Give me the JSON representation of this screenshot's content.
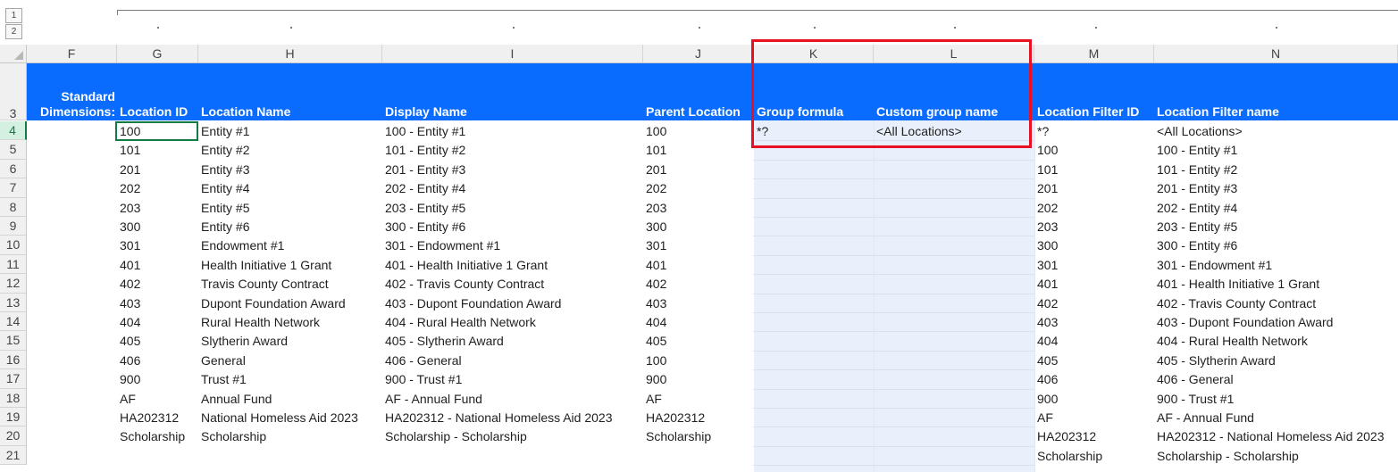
{
  "outline": {
    "levels": [
      "1",
      "2"
    ]
  },
  "columns": [
    {
      "letter": "F",
      "header": "Standard Dimensions:"
    },
    {
      "letter": "G",
      "header": "Location ID"
    },
    {
      "letter": "H",
      "header": "Location Name"
    },
    {
      "letter": "I",
      "header": "Display Name"
    },
    {
      "letter": "J",
      "header": "Parent Location"
    },
    {
      "letter": "K",
      "header": "Group formula"
    },
    {
      "letter": "L",
      "header": "Custom group name"
    },
    {
      "letter": "M",
      "header": "Location Filter ID"
    },
    {
      "letter": "N",
      "header": "Location Filter name"
    }
  ],
  "header_row_number": "3",
  "header_colors": {
    "band": "#0a6cff",
    "text": "#ffffff",
    "highlight_box": "#e81123",
    "group_fill": "#e8f0fb"
  },
  "rows": [
    {
      "n": "4",
      "G": "100",
      "H": "Entity #1",
      "I": "100 - Entity #1",
      "J": "100",
      "K": "*?",
      "L": "<All Locations>",
      "M": "*?",
      "N": "<All Locations>"
    },
    {
      "n": "5",
      "G": "101",
      "H": "Entity #2",
      "I": "101 - Entity #2",
      "J": "101",
      "K": "",
      "L": "",
      "M": "100",
      "N": "100 - Entity #1"
    },
    {
      "n": "6",
      "G": "201",
      "H": "Entity #3",
      "I": "201 - Entity #3",
      "J": "201",
      "K": "",
      "L": "",
      "M": "101",
      "N": "101 - Entity #2"
    },
    {
      "n": "7",
      "G": "202",
      "H": "Entity #4",
      "I": "202 - Entity #4",
      "J": "202",
      "K": "",
      "L": "",
      "M": "201",
      "N": "201 - Entity #3"
    },
    {
      "n": "8",
      "G": "203",
      "H": "Entity #5",
      "I": "203 - Entity #5",
      "J": "203",
      "K": "",
      "L": "",
      "M": "202",
      "N": "202 - Entity #4"
    },
    {
      "n": "9",
      "G": "300",
      "H": "Entity #6",
      "I": "300 - Entity #6",
      "J": "300",
      "K": "",
      "L": "",
      "M": "203",
      "N": "203 - Entity #5"
    },
    {
      "n": "10",
      "G": "301",
      "H": "Endowment #1",
      "I": "301 - Endowment #1",
      "J": "301",
      "K": "",
      "L": "",
      "M": "300",
      "N": "300 - Entity #6"
    },
    {
      "n": "11",
      "G": "401",
      "H": "Health Initiative 1 Grant",
      "I": "401 - Health Initiative 1 Grant",
      "J": "401",
      "K": "",
      "L": "",
      "M": "301",
      "N": "301 - Endowment #1"
    },
    {
      "n": "12",
      "G": "402",
      "H": "Travis County Contract",
      "I": "402 - Travis County Contract",
      "J": "402",
      "K": "",
      "L": "",
      "M": "401",
      "N": "401 - Health Initiative 1 Grant"
    },
    {
      "n": "13",
      "G": "403",
      "H": "Dupont Foundation Award",
      "I": "403 - Dupont Foundation Award",
      "J": "403",
      "K": "",
      "L": "",
      "M": "402",
      "N": "402 - Travis County Contract"
    },
    {
      "n": "14",
      "G": "404",
      "H": "Rural Health Network",
      "I": "404 - Rural Health Network",
      "J": "404",
      "K": "",
      "L": "",
      "M": "403",
      "N": "403 - Dupont Foundation Award"
    },
    {
      "n": "15",
      "G": "405",
      "H": "Slytherin Award",
      "I": "405 - Slytherin Award",
      "J": "405",
      "K": "",
      "L": "",
      "M": "404",
      "N": "404 - Rural Health Network"
    },
    {
      "n": "16",
      "G": "406",
      "H": "General",
      "I": "406 - General",
      "J": "100",
      "K": "",
      "L": "",
      "M": "405",
      "N": "405 - Slytherin Award"
    },
    {
      "n": "17",
      "G": "900",
      "H": "Trust #1",
      "I": "900 - Trust #1",
      "J": "900",
      "K": "",
      "L": "",
      "M": "406",
      "N": "406 - General"
    },
    {
      "n": "18",
      "G": "AF",
      "H": "Annual Fund",
      "I": "AF - Annual Fund",
      "J": "AF",
      "K": "",
      "L": "",
      "M": "900",
      "N": "900 - Trust #1"
    },
    {
      "n": "19",
      "G": "HA202312",
      "H": "National Homeless Aid 2023",
      "I": "HA202312 - National Homeless Aid 2023",
      "J": "HA202312",
      "K": "",
      "L": "",
      "M": "AF",
      "N": "AF - Annual Fund"
    },
    {
      "n": "20",
      "G": "Scholarship",
      "H": "Scholarship",
      "I": "Scholarship - Scholarship",
      "J": "Scholarship",
      "K": "",
      "L": "",
      "M": "HA202312",
      "N": "HA202312 - National Homeless Aid 2023"
    },
    {
      "n": "21",
      "G": "",
      "H": "",
      "I": "",
      "J": "",
      "K": "",
      "L": "",
      "M": "Scholarship",
      "N": "Scholarship - Scholarship"
    }
  ]
}
